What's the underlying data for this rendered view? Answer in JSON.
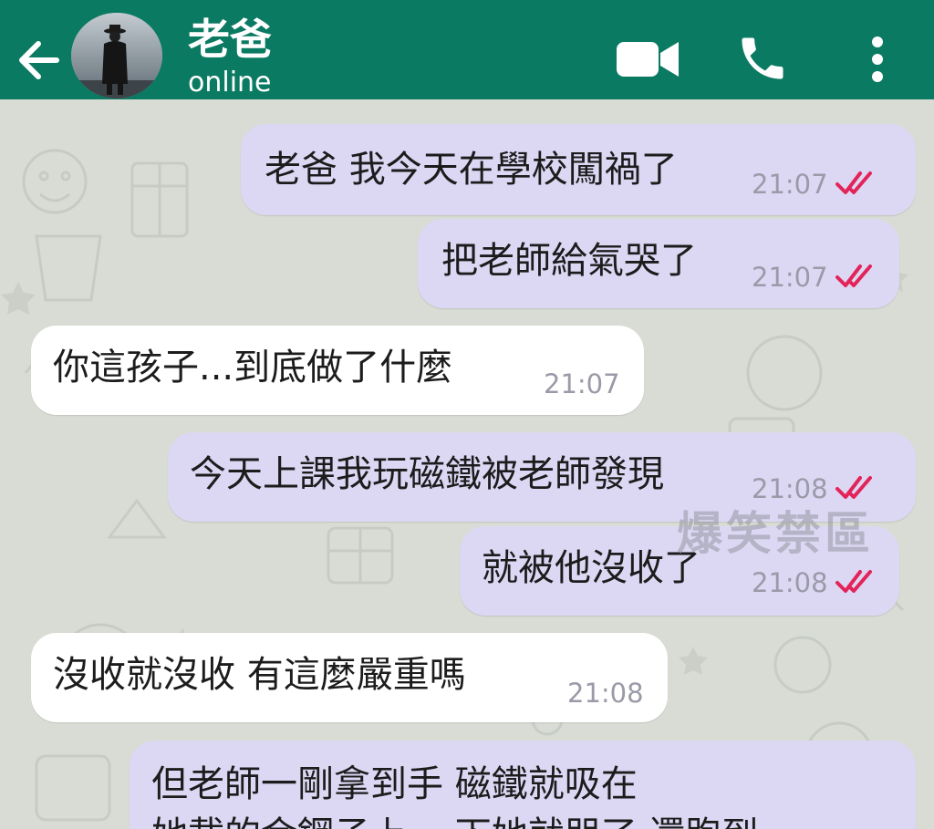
{
  "header": {
    "contact_name": "老爸",
    "status": "online"
  },
  "messages": [
    {
      "text": "老爸 我今天在學校闖禍了",
      "time": "21:07"
    },
    {
      "text": "把老師給氣哭了",
      "time": "21:07"
    },
    {
      "text": "你這孩子...到底做了什麼",
      "time": "21:07"
    },
    {
      "text": "今天上課我玩磁鐵被老師發現",
      "time": "21:08"
    },
    {
      "text": "就被他沒收了",
      "time": "21:08"
    },
    {
      "text": "沒收就沒收 有這麼嚴重嗎",
      "time": "21:08"
    },
    {
      "line1": "但老師一剛拿到手 磁鐵就吸在",
      "line2": "她載的金鋼子上 一下她就哭了 還跑到"
    }
  ],
  "watermark": "爆笑禁區",
  "colors": {
    "header": "#0b7a62",
    "outgoing_bubble": "#dcd8f4",
    "incoming_bubble": "#ffffff",
    "read_ticks": "#e3245a"
  },
  "icons": [
    "back-arrow-icon",
    "video-camera-icon",
    "phone-icon",
    "more-vertical-icon",
    "double-check-icon"
  ]
}
